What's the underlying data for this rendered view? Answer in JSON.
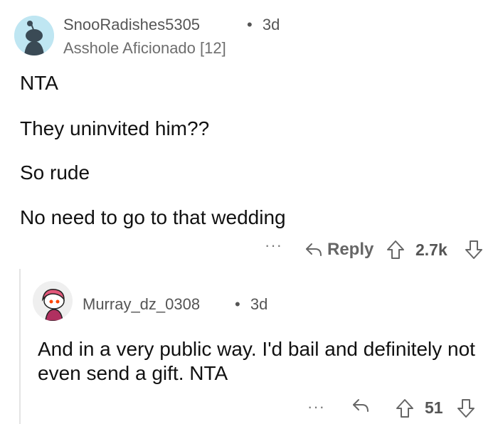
{
  "comment": {
    "username": "SnooRadishes5305",
    "separator": "•",
    "age": "3d",
    "flair": "Asshole Aficionado [12]",
    "paragraphs": [
      "NTA",
      "They uninvited him??",
      "So rude",
      "No need to go to that wedding"
    ],
    "actions": {
      "more_label": "···",
      "reply_label": "Reply",
      "score": "2.7k"
    }
  },
  "reply": {
    "username": "Murray_dz_0308",
    "separator": "•",
    "age": "3d",
    "text": "And in a very public way. I'd bail and definitely not even send a gift. NTA",
    "actions": {
      "more_label": "···",
      "score": "51"
    }
  },
  "colors": {
    "avatar1_bg": "#bfe6f2",
    "avatar2_hair": "#e2587a",
    "action_gray": "#666666",
    "thread_line": "#e4e4e4"
  },
  "icons": {
    "avatar1": "snoo-avatar-icon",
    "avatar2": "snoo-avatar-icon",
    "reply": "reply-arrow-icon",
    "upvote": "upvote-arrow-icon",
    "downvote": "downvote-arrow-icon",
    "more": "more-options-icon"
  }
}
